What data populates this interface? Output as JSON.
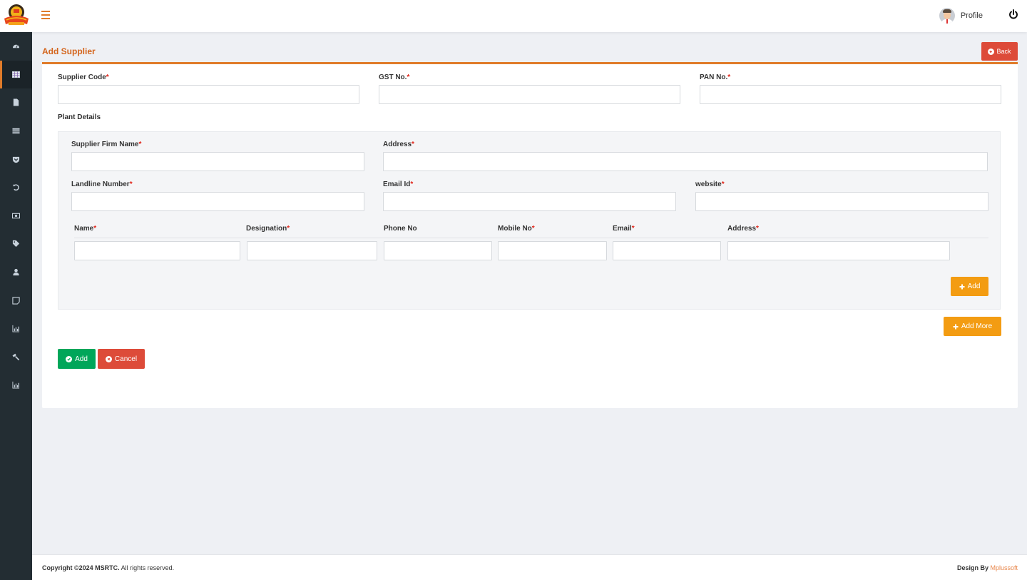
{
  "app": {
    "logo_alt": "MSRTC logo"
  },
  "header": {
    "profile_label": "Profile",
    "icons": {
      "menu": "hamburger-icon",
      "profile": "avatar",
      "logout": "power-icon"
    }
  },
  "sidebar": {
    "items": [
      {
        "icon": "dashboard-icon",
        "active": false
      },
      {
        "icon": "table-icon",
        "active": true
      },
      {
        "icon": "file-icon",
        "active": false
      },
      {
        "icon": "list-icon",
        "active": false
      },
      {
        "icon": "pocket-icon",
        "active": false
      },
      {
        "icon": "undo-icon",
        "active": false
      },
      {
        "icon": "money-icon",
        "active": false
      },
      {
        "icon": "tag-icon",
        "active": false
      },
      {
        "icon": "user-icon",
        "active": false
      },
      {
        "icon": "note-icon",
        "active": false
      },
      {
        "icon": "bar-chart-icon",
        "active": false
      },
      {
        "icon": "gavel-icon",
        "active": false
      },
      {
        "icon": "bar-chart-icon",
        "active": false
      }
    ]
  },
  "page": {
    "title": "Add Supplier",
    "back_label": "Back",
    "required_marker": "*"
  },
  "form": {
    "supplier_code": {
      "label": "Supplier Code",
      "value": "",
      "required": true
    },
    "gst_no": {
      "label": "GST No.",
      "value": "",
      "required": true
    },
    "pan_no": {
      "label": "PAN No.",
      "value": "",
      "required": true
    },
    "plant_details_heading": "Plant Details",
    "plant": {
      "firm_name": {
        "label": "Supplier Firm Name",
        "value": "",
        "required": true
      },
      "address": {
        "label": "Address",
        "value": "",
        "required": true
      },
      "landline": {
        "label": "Landline Number",
        "value": "",
        "required": true
      },
      "email_id": {
        "label": "Email Id",
        "value": "",
        "required": true
      },
      "website": {
        "label": "website",
        "value": "",
        "required": true
      },
      "contact_columns": [
        {
          "label": "Name",
          "required": true
        },
        {
          "label": "Designation",
          "required": true
        },
        {
          "label": "Phone No",
          "required": false
        },
        {
          "label": "Mobile No",
          "required": true
        },
        {
          "label": "Email",
          "required": true
        },
        {
          "label": "Address",
          "required": true
        }
      ],
      "contact_row": [
        "",
        "",
        "",
        "",
        "",
        ""
      ],
      "add_label": "Add"
    },
    "add_more_label": "Add More",
    "submit_label": "Add",
    "cancel_label": "Cancel"
  },
  "colors": {
    "accent": "#e07b2a",
    "danger": "#dd4b39",
    "success": "#00a65a",
    "warning": "#f39c12",
    "sidebar_bg": "#232d33"
  },
  "footer": {
    "copyright_bold": "Copyright ©2024 MSRTC.",
    "copyright_rest": " All rights reserved.",
    "design_by": "Design By ",
    "designer": "Mplussoft"
  }
}
